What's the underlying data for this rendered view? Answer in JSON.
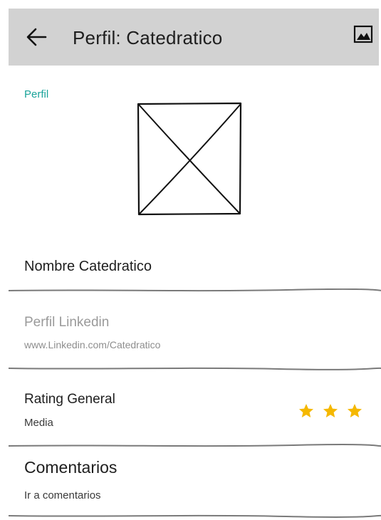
{
  "header": {
    "title": "Perfil: Catedratico",
    "back_icon": "arrow-left-icon",
    "action_icon": "image-icon",
    "background": "#d2d2d2"
  },
  "profile": {
    "section_label": "Perfil",
    "section_label_color": "#1aa39a",
    "photo_icon": "image-placeholder-icon"
  },
  "fields": {
    "name": {
      "value": "Nombre Catedratico"
    },
    "linkedin": {
      "label": "Perfil Linkedin",
      "value": "www.Linkedin.com/Catedratico"
    },
    "rating": {
      "label": "Rating General",
      "value": "Media",
      "stars_filled": 3,
      "star_color": "#f5b800"
    },
    "comments": {
      "label": "Comentarios",
      "link": "Ir a comentarios"
    }
  }
}
